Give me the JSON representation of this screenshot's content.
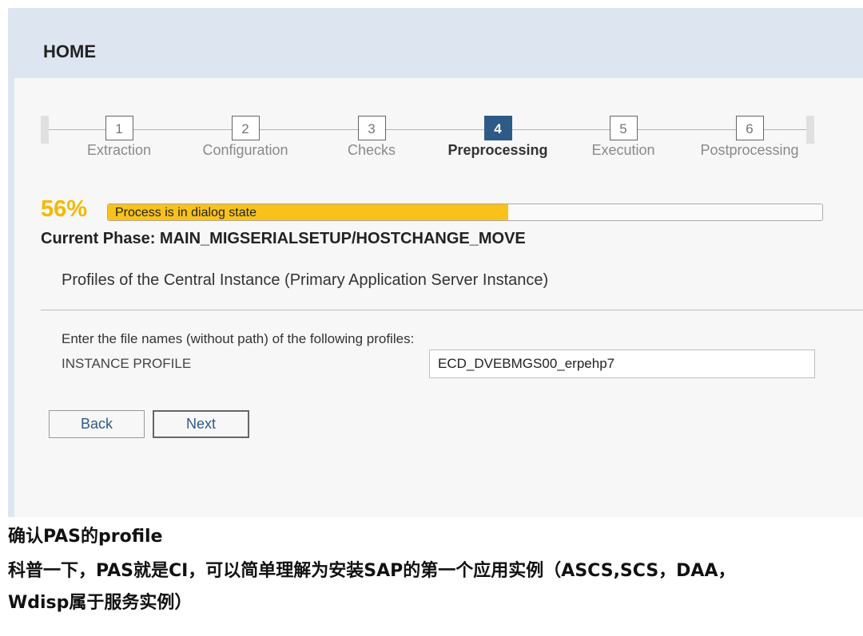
{
  "header": {
    "title": "HOME"
  },
  "wizard": {
    "steps": [
      {
        "number": "1",
        "label": "Extraction",
        "active": false
      },
      {
        "number": "2",
        "label": "Configuration",
        "active": false
      },
      {
        "number": "3",
        "label": "Checks",
        "active": false
      },
      {
        "number": "4",
        "label": "Preprocessing",
        "active": true
      },
      {
        "number": "5",
        "label": "Execution",
        "active": false
      },
      {
        "number": "6",
        "label": "Postprocessing",
        "active": false
      }
    ]
  },
  "progress": {
    "percent_label": "56%",
    "fraction": 0.56,
    "status_text": "Process is in dialog state",
    "fill_color": "#f8c21a"
  },
  "phase": {
    "label": "Current Phase: MAIN_MIGSERIALSETUP/HOSTCHANGE_MOVE"
  },
  "section": {
    "title": "Profiles of the Central Instance (Primary Application Server Instance)",
    "instruction": "Enter the file names (without path) of the following profiles:",
    "field_label": "INSTANCE PROFILE",
    "field_value": "ECD_DVEBMGS00_erpehp7"
  },
  "buttons": {
    "back_label": "Back",
    "next_label": "Next"
  },
  "caption": {
    "line1": "确认PAS的profile",
    "line2": "科普一下，PAS就是CI，可以简单理解为安装SAP的第一个应用实例（ASCS,SCS，DAA，",
    "line3": "Wdisp属于服务实例）"
  },
  "colors": {
    "accent": "#2e5a87",
    "percent": "#f5b800",
    "header_bg": "#dde6f0"
  }
}
